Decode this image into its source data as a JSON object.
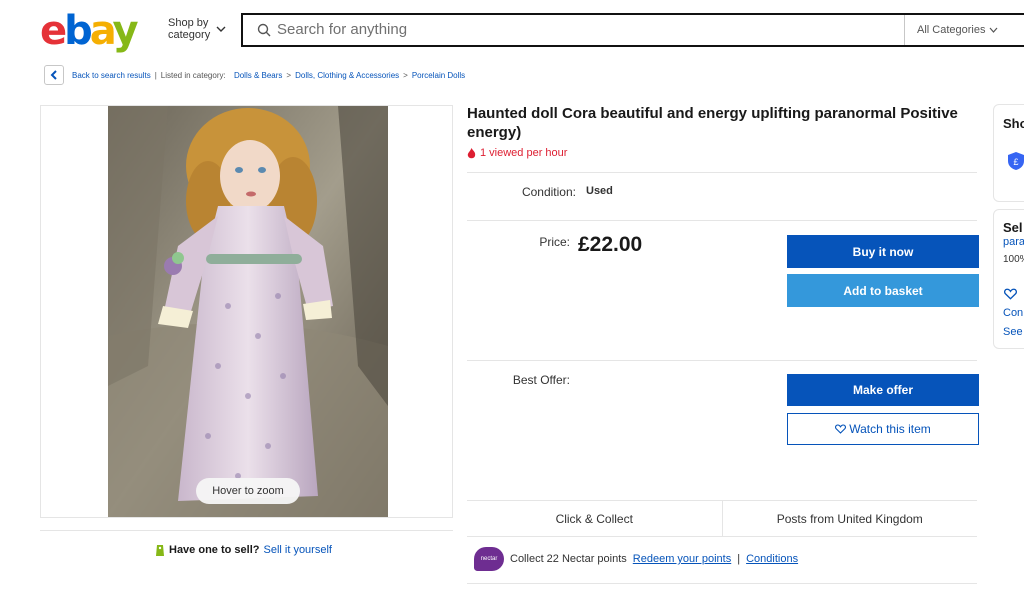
{
  "header": {
    "logo": {
      "e": "e",
      "b": "b",
      "a": "a",
      "y": "y"
    },
    "shop_by_label": "Shop by category",
    "search_placeholder": "Search for anything",
    "category_select": "All Categories"
  },
  "breadcrumb": {
    "back_label": "Back to search results",
    "listed_in": "Listed in category:",
    "items": [
      "Dolls & Bears",
      "Dolls, Clothing & Accessories",
      "Porcelain Dolls"
    ]
  },
  "gallery": {
    "zoom_hint": "Hover to zoom"
  },
  "sell": {
    "prompt": "Have one to sell?",
    "link": "Sell it yourself"
  },
  "listing": {
    "title": "Haunted doll Cora beautiful and energy uplifting paranormal Positive energy)",
    "viewed": "1 viewed per hour",
    "condition_label": "Condition:",
    "condition_value": "Used",
    "price_label": "Price:",
    "price": "£22.00",
    "buy_now": "Buy it now",
    "add_to_basket": "Add to basket",
    "best_offer_label": "Best Offer:",
    "make_offer": "Make offer",
    "watch": "Watch this item"
  },
  "shipping": {
    "click_collect": "Click & Collect",
    "posts_from": "Posts from United Kingdom"
  },
  "nectar": {
    "badge": "nectar",
    "text": "Collect 22 Nectar points",
    "redeem": "Redeem your points",
    "separator": "|",
    "conditions": "Conditions"
  },
  "side_cards": {
    "card1_title": "Sho",
    "card2_title": "Sel",
    "card2_seller": "para",
    "card2_feedback": "100%",
    "card2_link1": "Con",
    "card2_link2": "See"
  },
  "colors": {
    "primary_blue": "#0654ba",
    "secondary_blue": "#3498db",
    "alert_red": "#dd1e31",
    "nectar_purple": "#6e2d91"
  }
}
